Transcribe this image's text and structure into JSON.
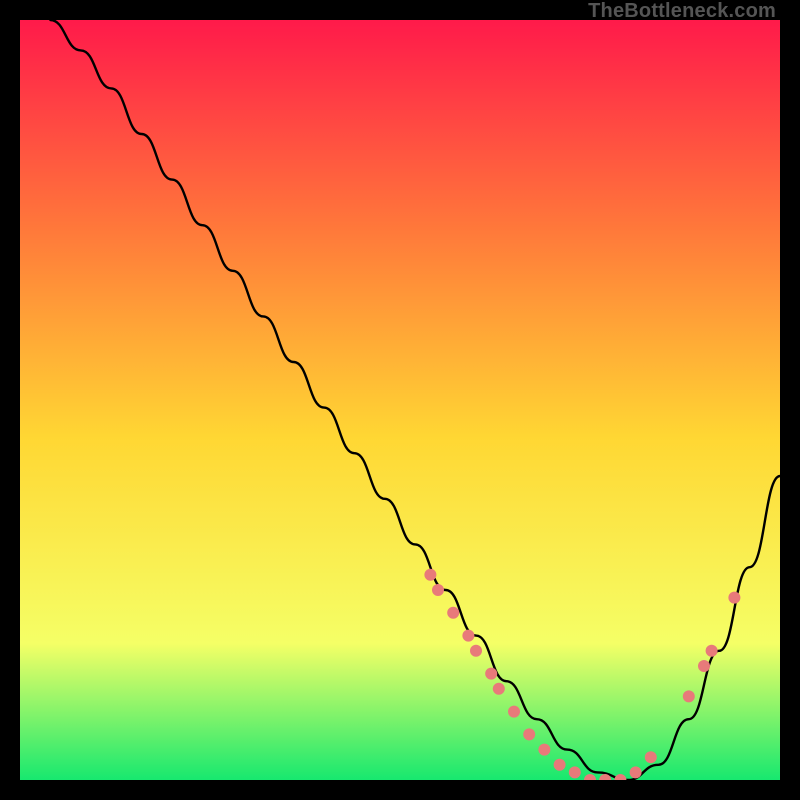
{
  "watermark": "TheBottleneck.com",
  "chart_data": {
    "type": "line",
    "title": "",
    "xlabel": "",
    "ylabel": "",
    "xlim": [
      0,
      100
    ],
    "ylim": [
      0,
      100
    ],
    "grid": false,
    "legend": false,
    "background_gradient": {
      "top": "#ff1a4a",
      "mid_upper": "#ff7a3a",
      "mid": "#ffd733",
      "mid_lower": "#f5ff66",
      "bottom": "#17e86f"
    },
    "series": [
      {
        "name": "bottleneck-curve",
        "color": "#000000",
        "x": [
          4,
          8,
          12,
          16,
          20,
          24,
          28,
          32,
          36,
          40,
          44,
          48,
          52,
          56,
          60,
          64,
          68,
          72,
          76,
          80,
          84,
          88,
          92,
          96,
          100
        ],
        "y": [
          100,
          96,
          91,
          85,
          79,
          73,
          67,
          61,
          55,
          49,
          43,
          37,
          31,
          25,
          19,
          13,
          8,
          4,
          1,
          0,
          2,
          8,
          17,
          28,
          40
        ]
      }
    ],
    "marker_points": {
      "color": "#e87a7a",
      "points": [
        {
          "x": 54,
          "y": 27
        },
        {
          "x": 55,
          "y": 25
        },
        {
          "x": 57,
          "y": 22
        },
        {
          "x": 59,
          "y": 19
        },
        {
          "x": 60,
          "y": 17
        },
        {
          "x": 62,
          "y": 14
        },
        {
          "x": 63,
          "y": 12
        },
        {
          "x": 65,
          "y": 9
        },
        {
          "x": 67,
          "y": 6
        },
        {
          "x": 69,
          "y": 4
        },
        {
          "x": 71,
          "y": 2
        },
        {
          "x": 73,
          "y": 1
        },
        {
          "x": 75,
          "y": 0
        },
        {
          "x": 77,
          "y": 0
        },
        {
          "x": 79,
          "y": 0
        },
        {
          "x": 81,
          "y": 1
        },
        {
          "x": 83,
          "y": 3
        },
        {
          "x": 88,
          "y": 11
        },
        {
          "x": 90,
          "y": 15
        },
        {
          "x": 91,
          "y": 17
        },
        {
          "x": 94,
          "y": 24
        }
      ]
    }
  }
}
